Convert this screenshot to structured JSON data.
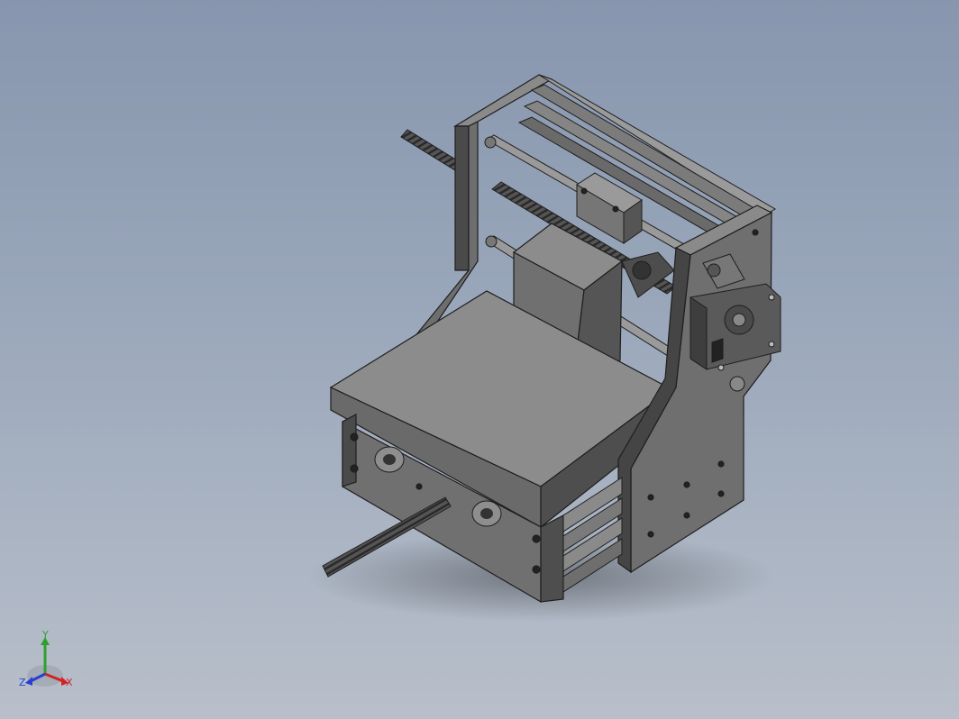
{
  "viewport": {
    "background_top": "#8796ae",
    "background_bottom": "#b8bfca"
  },
  "model": {
    "part_color": "#6e6e6e",
    "part_shadow": "#3e3e3e",
    "edge_color": "#1e1e1e"
  },
  "triad": {
    "x_label": "X",
    "y_label": "Y",
    "z_label": "Z",
    "x_color": "#d32222",
    "y_color": "#2fa02f",
    "z_color": "#2a3fd0"
  }
}
